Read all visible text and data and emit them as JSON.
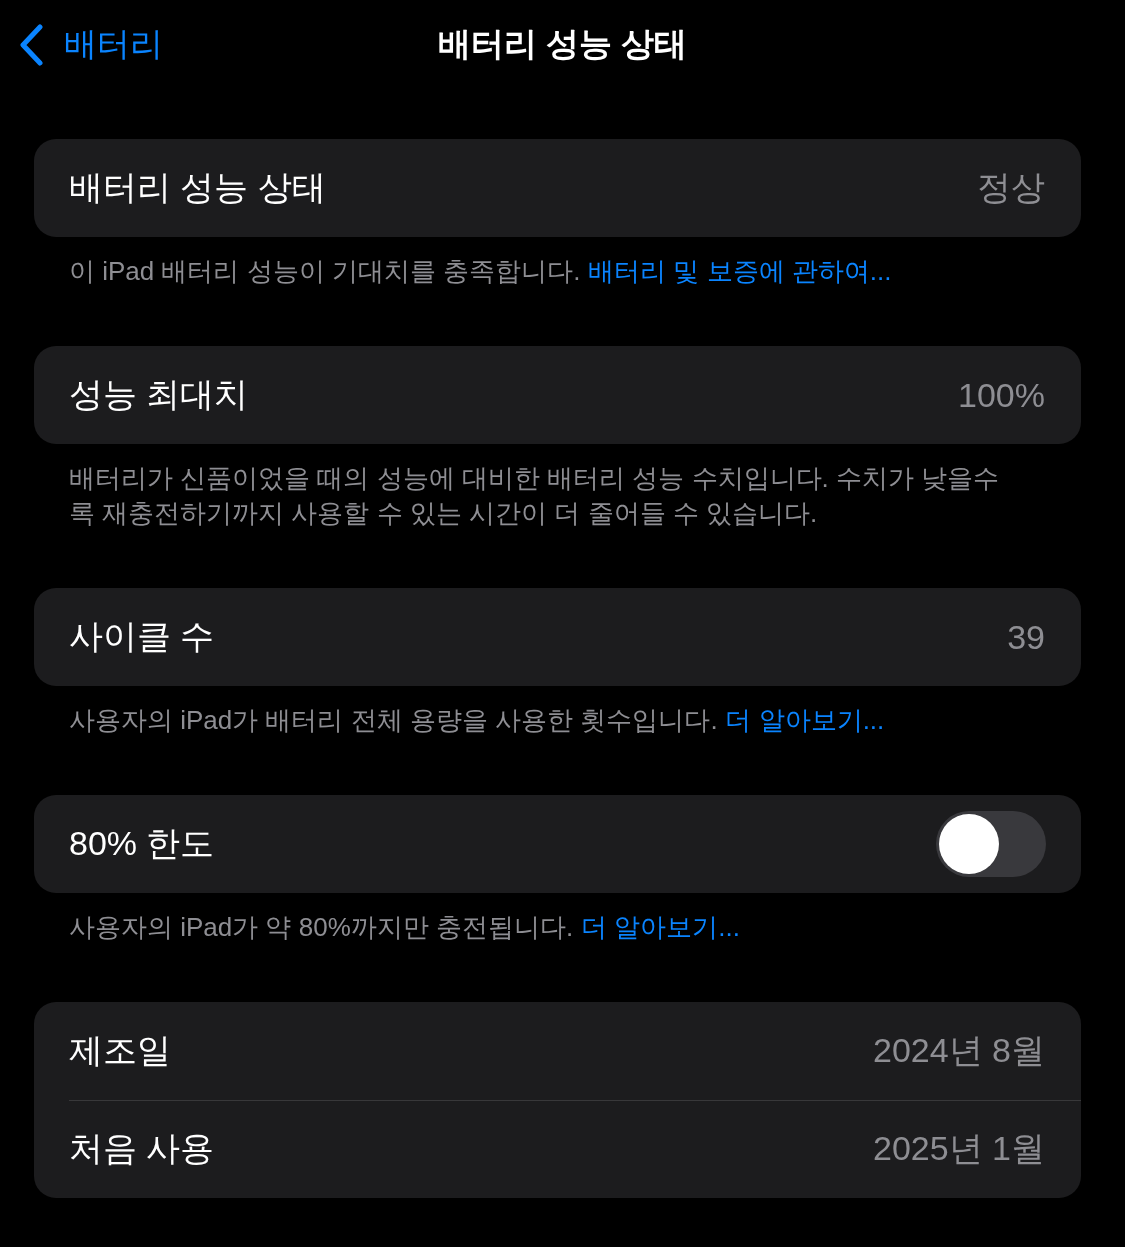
{
  "nav": {
    "back": "배터리",
    "title": "배터리 성능 상태"
  },
  "sections": [
    {
      "rows": [
        {
          "kind": "value",
          "label": "배터리 성능 상태",
          "value": "정상"
        }
      ],
      "footer": {
        "text": "이 iPad 배터리 성능이 기대치를 충족합니다.",
        "link": "배터리 및 보증에 관하여..."
      }
    },
    {
      "rows": [
        {
          "kind": "value",
          "label": "성능 최대치",
          "value": "100%"
        }
      ],
      "footer": {
        "text": "배터리가 신품이었을 때의 성능에 대비한 배터리 성능 수치입니다. 수치가 낮을수록 재충전하기까지 사용할 수 있는 시간이 더 줄어들 수 있습니다."
      }
    },
    {
      "rows": [
        {
          "kind": "value",
          "label": "사이클 수",
          "value": "39"
        }
      ],
      "footer": {
        "text": "사용자의 iPad가 배터리 전체 용량을 사용한 횟수입니다.",
        "link": "더 알아보기..."
      }
    },
    {
      "rows": [
        {
          "kind": "toggle",
          "label": "80% 한도",
          "on": false
        }
      ],
      "footer": {
        "text": "사용자의 iPad가 약 80%까지만 충전됩니다.",
        "link": "더 알아보기..."
      }
    },
    {
      "rows": [
        {
          "kind": "value",
          "label": "제조일",
          "value": "2024년 8월"
        },
        {
          "kind": "value",
          "label": "처음 사용",
          "value": "2025년 1월"
        }
      ]
    }
  ]
}
